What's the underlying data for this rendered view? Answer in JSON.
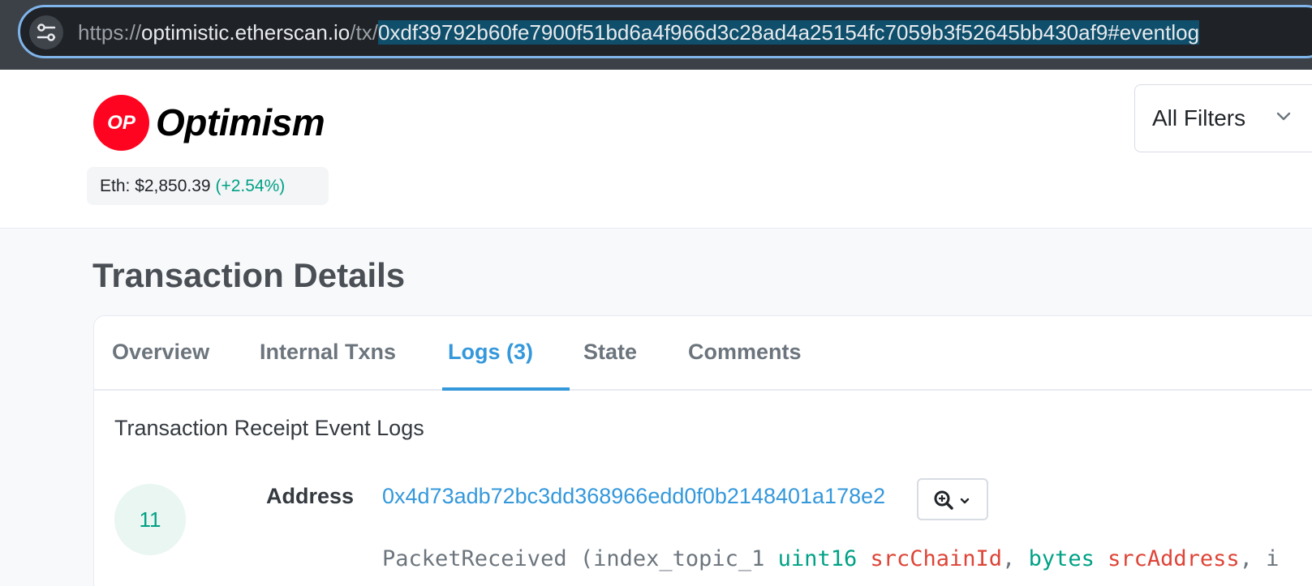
{
  "browser": {
    "url_scheme": "https://",
    "url_host": "optimistic.etherscan.io",
    "url_path": "/tx/",
    "url_selected": "0xdf39792b60fe7900f51bd6a4f966d3c28ad4a25154fc7059b3f52645bb430af9",
    "url_hash": "#eventlog",
    "site_info_icon": "tune-icon"
  },
  "header": {
    "logo_text": "OP",
    "brand": "Optimism",
    "price_label": "Eth: $2,850.39",
    "price_change": "(+2.54%)",
    "filter_label": "All Filters"
  },
  "main": {
    "page_title": "Transaction Details",
    "tabs": [
      {
        "label": "Overview",
        "active": false
      },
      {
        "label": "Internal Txns",
        "active": false
      },
      {
        "label": "Logs (3)",
        "active": true
      },
      {
        "label": "State",
        "active": false
      },
      {
        "label": "Comments",
        "active": false
      }
    ],
    "section_title": "Transaction Receipt Event Logs",
    "log": {
      "index": "11",
      "address_label": "Address",
      "address": "0x4d73adb72bc3dd368966edd0f0b2148401a178e2",
      "event_name": "PacketReceived (index_topic_1 ",
      "p1_type": "uint16",
      "p1_name": "srcChainId",
      "sep": ", ",
      "p2_type": "bytes",
      "p2_name": "srcAddress",
      "tail": ", i"
    }
  },
  "colors": {
    "accent": "#3498db",
    "success": "#00a186",
    "param_name": "#de4437",
    "op_red": "#ff0420"
  }
}
